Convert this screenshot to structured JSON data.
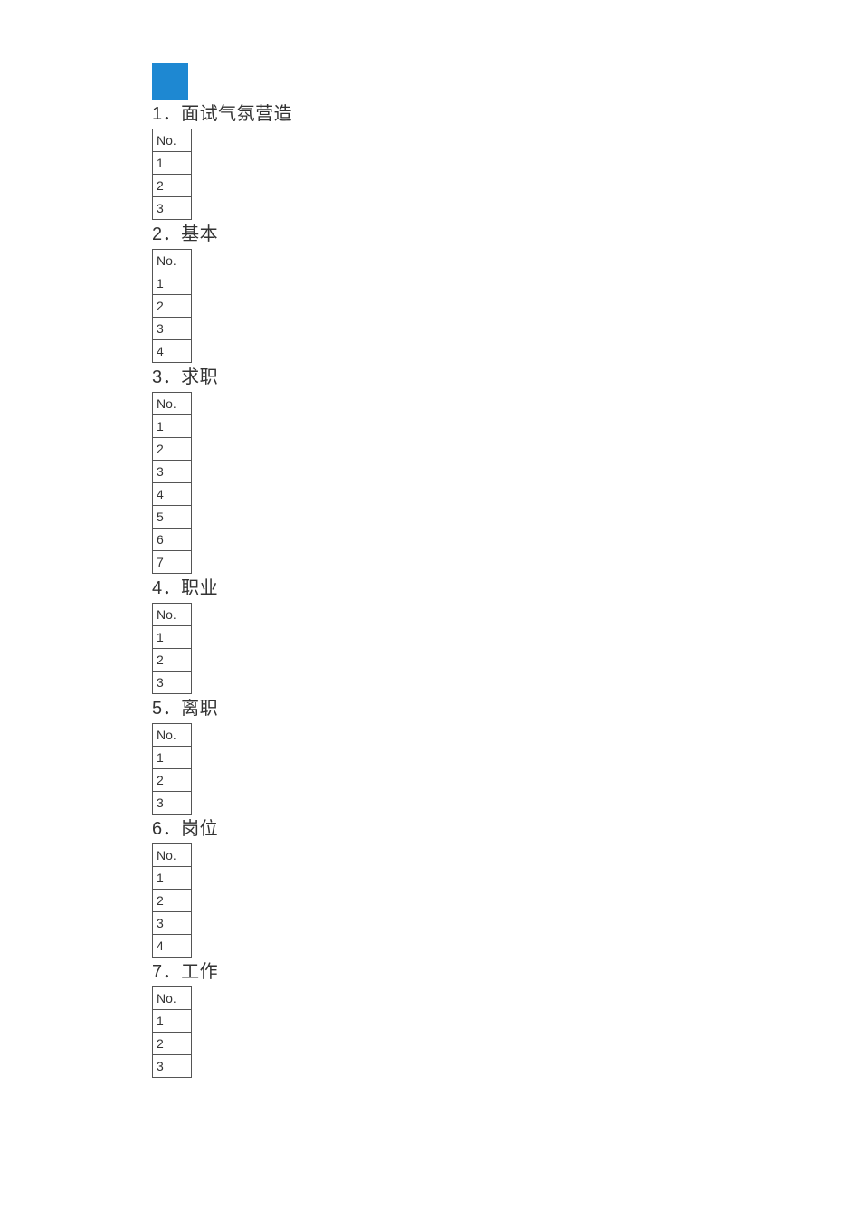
{
  "header_label": "No.",
  "sections": [
    {
      "title": "1．面试气氛营造",
      "rows": [
        "1",
        "2",
        "3"
      ]
    },
    {
      "title": "2．基本",
      "rows": [
        "1",
        "2",
        "3",
        "4"
      ]
    },
    {
      "title": "3．求职",
      "rows": [
        "1",
        "2",
        "3",
        "4",
        "5",
        "6",
        "7"
      ]
    },
    {
      "title": "4．职业",
      "rows": [
        "1",
        "2",
        "3"
      ]
    },
    {
      "title": "5．离职",
      "rows": [
        "1",
        "2",
        "3"
      ]
    },
    {
      "title": "6．岗位",
      "rows": [
        "1",
        "2",
        "3",
        "4"
      ]
    },
    {
      "title": "7．工作",
      "rows": [
        "1",
        "2",
        "3"
      ]
    }
  ]
}
